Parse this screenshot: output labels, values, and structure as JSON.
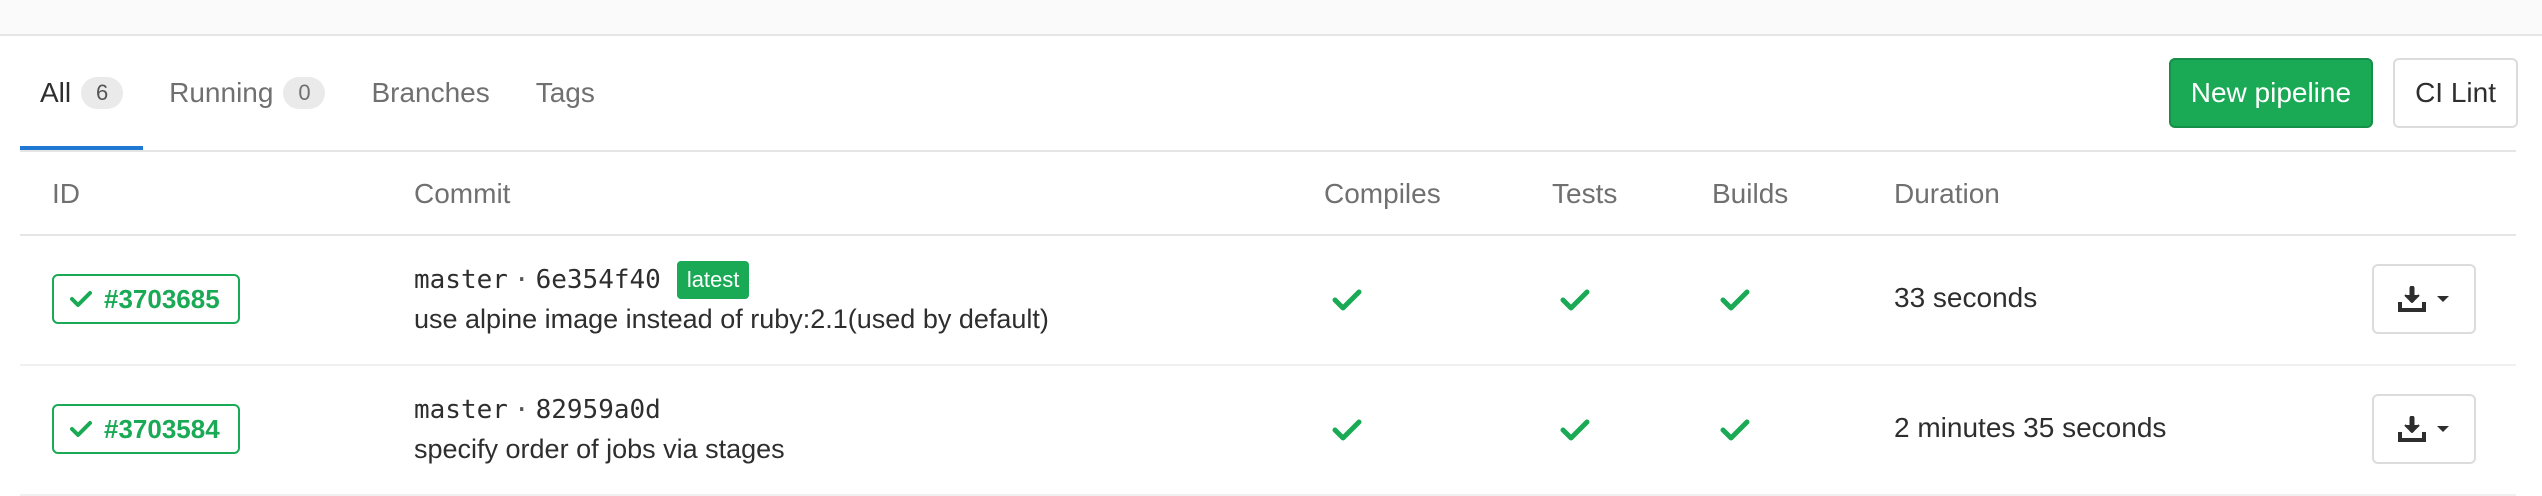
{
  "tabs": [
    {
      "label": "All",
      "count": "6",
      "active": true
    },
    {
      "label": "Running",
      "count": "0",
      "active": false
    },
    {
      "label": "Branches",
      "active": false
    },
    {
      "label": "Tags",
      "active": false
    }
  ],
  "actions": {
    "new_pipeline": "New pipeline",
    "ci_lint": "CI Lint"
  },
  "table": {
    "headers": {
      "id": "ID",
      "commit": "Commit",
      "compiles": "Compiles",
      "tests": "Tests",
      "builds": "Builds",
      "duration": "Duration"
    },
    "rows": [
      {
        "status": "passed",
        "id": "#3703685",
        "ref": "master",
        "sha": "6e354f40",
        "latest_badge": "latest",
        "message": "use alpine image instead of ruby:2.1(used by default)",
        "stages": {
          "compiles": "success",
          "tests": "success",
          "builds": "success"
        },
        "duration": "33 seconds",
        "artifacts_icon": "download-icon"
      },
      {
        "status": "passed",
        "id": "#3703584",
        "ref": "master",
        "sha": "82959a0d",
        "message": "specify order of jobs via stages",
        "stages": {
          "compiles": "success",
          "tests": "success",
          "builds": "success"
        },
        "duration": "2 minutes 35 seconds",
        "artifacts_icon": "download-icon"
      }
    ]
  },
  "colors": {
    "success": "#1aaa55",
    "tab_active_border": "#1f78d1",
    "text_muted": "#707070"
  }
}
